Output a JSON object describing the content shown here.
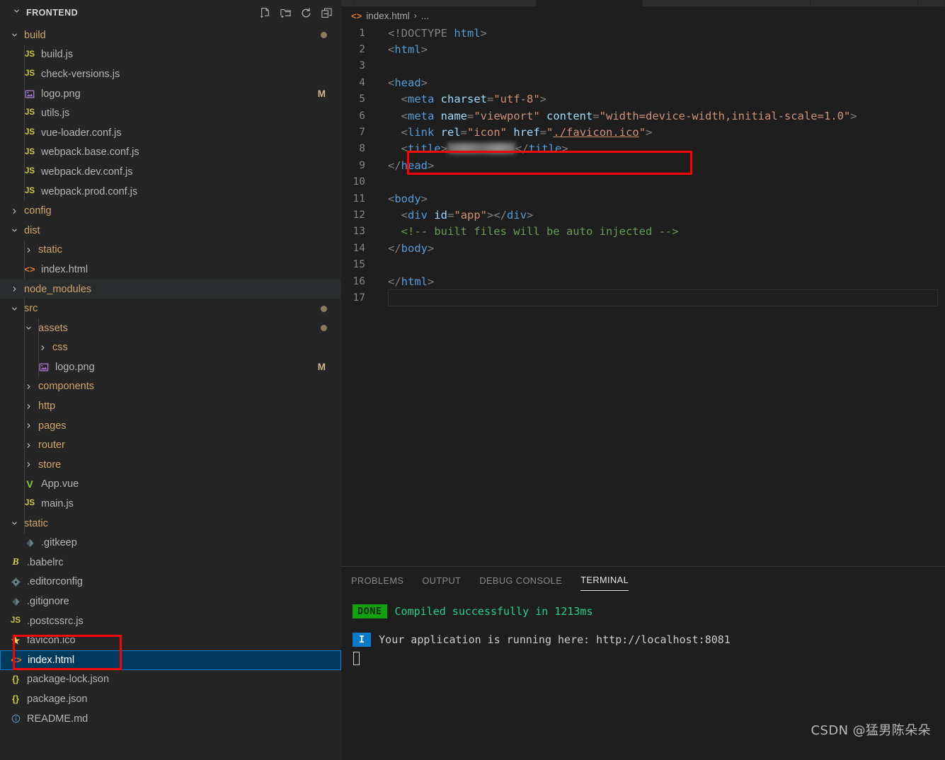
{
  "sidebar": {
    "title": "FRONTEND",
    "actions": [
      {
        "name": "new-file-icon",
        "label": "New File"
      },
      {
        "name": "new-folder-icon",
        "label": "New Folder"
      },
      {
        "name": "refresh-icon",
        "label": "Refresh Explorer"
      },
      {
        "name": "collapse-all-icon",
        "label": "Collapse Folders in Explorer"
      }
    ],
    "tree": [
      {
        "label": "build",
        "type": "folder",
        "depth": 0,
        "expanded": true,
        "icon": "chevron-down-icon",
        "badge": "",
        "dot": true
      },
      {
        "label": "build.js",
        "type": "js",
        "depth": 1,
        "icon": "js-icon",
        "badge": ""
      },
      {
        "label": "check-versions.js",
        "type": "js",
        "depth": 1,
        "icon": "js-icon",
        "badge": ""
      },
      {
        "label": "logo.png",
        "type": "image",
        "depth": 1,
        "icon": "image-icon",
        "badge": "M"
      },
      {
        "label": "utils.js",
        "type": "js",
        "depth": 1,
        "icon": "js-icon",
        "badge": ""
      },
      {
        "label": "vue-loader.conf.js",
        "type": "js",
        "depth": 1,
        "icon": "js-icon",
        "badge": ""
      },
      {
        "label": "webpack.base.conf.js",
        "type": "js",
        "depth": 1,
        "icon": "js-icon",
        "badge": ""
      },
      {
        "label": "webpack.dev.conf.js",
        "type": "js",
        "depth": 1,
        "icon": "js-icon",
        "badge": ""
      },
      {
        "label": "webpack.prod.conf.js",
        "type": "js",
        "depth": 1,
        "icon": "js-icon",
        "badge": ""
      },
      {
        "label": "config",
        "type": "folder",
        "depth": 0,
        "expanded": false,
        "icon": "chevron-right-icon",
        "badge": ""
      },
      {
        "label": "dist",
        "type": "folder",
        "depth": 0,
        "expanded": true,
        "icon": "chevron-down-icon",
        "badge": ""
      },
      {
        "label": "static",
        "type": "folder",
        "depth": 1,
        "expanded": false,
        "icon": "chevron-right-icon",
        "badge": ""
      },
      {
        "label": "index.html",
        "type": "html",
        "depth": 1,
        "icon": "html-icon",
        "badge": ""
      },
      {
        "label": "node_modules",
        "type": "folder",
        "depth": 0,
        "expanded": false,
        "icon": "chevron-right-icon",
        "badge": "",
        "hover": true
      },
      {
        "label": "src",
        "type": "folder",
        "depth": 0,
        "expanded": true,
        "icon": "chevron-down-icon",
        "badge": "",
        "dot": true
      },
      {
        "label": "assets",
        "type": "folder",
        "depth": 1,
        "expanded": true,
        "icon": "chevron-down-icon",
        "badge": "",
        "dot": true
      },
      {
        "label": "css",
        "type": "folder",
        "depth": 2,
        "expanded": false,
        "icon": "chevron-right-icon",
        "badge": ""
      },
      {
        "label": "logo.png",
        "type": "image",
        "depth": 2,
        "icon": "image-icon",
        "badge": "M"
      },
      {
        "label": "components",
        "type": "folder",
        "depth": 1,
        "expanded": false,
        "icon": "chevron-right-icon",
        "badge": ""
      },
      {
        "label": "http",
        "type": "folder",
        "depth": 1,
        "expanded": false,
        "icon": "chevron-right-icon",
        "badge": ""
      },
      {
        "label": "pages",
        "type": "folder",
        "depth": 1,
        "expanded": false,
        "icon": "chevron-right-icon",
        "badge": ""
      },
      {
        "label": "router",
        "type": "folder",
        "depth": 1,
        "expanded": false,
        "icon": "chevron-right-icon",
        "badge": ""
      },
      {
        "label": "store",
        "type": "folder",
        "depth": 1,
        "expanded": false,
        "icon": "chevron-right-icon",
        "badge": ""
      },
      {
        "label": "App.vue",
        "type": "vue",
        "depth": 1,
        "icon": "vue-icon",
        "badge": ""
      },
      {
        "label": "main.js",
        "type": "js",
        "depth": 1,
        "icon": "js-icon",
        "badge": ""
      },
      {
        "label": "static",
        "type": "folder",
        "depth": 0,
        "expanded": true,
        "icon": "chevron-down-icon",
        "badge": ""
      },
      {
        "label": ".gitkeep",
        "type": "git",
        "depth": 1,
        "icon": "git-icon",
        "badge": ""
      },
      {
        "label": ".babelrc",
        "type": "babel",
        "depth": 0,
        "icon": "babel-icon",
        "badge": ""
      },
      {
        "label": ".editorconfig",
        "type": "gear",
        "depth": 0,
        "icon": "gear-icon",
        "badge": ""
      },
      {
        "label": ".gitignore",
        "type": "git",
        "depth": 0,
        "icon": "git-icon",
        "badge": ""
      },
      {
        "label": ".postcssrc.js",
        "type": "js",
        "depth": 0,
        "icon": "js-icon",
        "badge": ""
      },
      {
        "label": "favicon.ico",
        "type": "star",
        "depth": 0,
        "icon": "star-icon",
        "badge": ""
      },
      {
        "label": "index.html",
        "type": "html",
        "depth": 0,
        "icon": "html-icon",
        "badge": "",
        "selected": true
      },
      {
        "label": "package-lock.json",
        "type": "json",
        "depth": 0,
        "icon": "json-icon",
        "badge": ""
      },
      {
        "label": "package.json",
        "type": "json",
        "depth": 0,
        "icon": "json-icon",
        "badge": ""
      },
      {
        "label": "README.md",
        "type": "md",
        "depth": 0,
        "icon": "info-icon",
        "badge": ""
      }
    ]
  },
  "editor": {
    "breadcrumb": {
      "file": "index.html",
      "separator": "›",
      "rest": "..."
    },
    "lines": [
      {
        "n": "1",
        "tokens": [
          {
            "t": "<!DOCTYPE ",
            "c": "t-punct"
          },
          {
            "t": "html",
            "c": "t-tag"
          },
          {
            "t": ">",
            "c": "t-punct"
          }
        ]
      },
      {
        "n": "2",
        "tokens": [
          {
            "t": "<",
            "c": "t-punct"
          },
          {
            "t": "html",
            "c": "t-tag"
          },
          {
            "t": ">",
            "c": "t-punct"
          }
        ]
      },
      {
        "n": "3",
        "tokens": []
      },
      {
        "n": "4",
        "tokens": [
          {
            "t": "<",
            "c": "t-punct"
          },
          {
            "t": "head",
            "c": "t-tag"
          },
          {
            "t": ">",
            "c": "t-punct"
          }
        ]
      },
      {
        "n": "5",
        "tokens": [
          {
            "t": "  <",
            "c": "t-punct"
          },
          {
            "t": "meta",
            "c": "t-tag"
          },
          {
            "t": " ",
            "c": "t-plain"
          },
          {
            "t": "charset",
            "c": "t-attr"
          },
          {
            "t": "=",
            "c": "t-punct"
          },
          {
            "t": "\"utf-8\"",
            "c": "t-str"
          },
          {
            "t": ">",
            "c": "t-punct"
          }
        ]
      },
      {
        "n": "6",
        "tokens": [
          {
            "t": "  <",
            "c": "t-punct"
          },
          {
            "t": "meta",
            "c": "t-tag"
          },
          {
            "t": " ",
            "c": "t-plain"
          },
          {
            "t": "name",
            "c": "t-attr"
          },
          {
            "t": "=",
            "c": "t-punct"
          },
          {
            "t": "\"viewport\"",
            "c": "t-str"
          },
          {
            "t": " ",
            "c": "t-plain"
          },
          {
            "t": "content",
            "c": "t-attr"
          },
          {
            "t": "=",
            "c": "t-punct"
          },
          {
            "t": "\"width=device-width,initial-scale=1.0\"",
            "c": "t-str"
          },
          {
            "t": ">",
            "c": "t-punct"
          }
        ]
      },
      {
        "n": "7",
        "tokens": [
          {
            "t": "  <",
            "c": "t-punct"
          },
          {
            "t": "link",
            "c": "t-tag"
          },
          {
            "t": " ",
            "c": "t-plain"
          },
          {
            "t": "rel",
            "c": "t-attr"
          },
          {
            "t": "=",
            "c": "t-punct"
          },
          {
            "t": "\"icon\"",
            "c": "t-str"
          },
          {
            "t": " ",
            "c": "t-plain"
          },
          {
            "t": "href",
            "c": "t-attr"
          },
          {
            "t": "=",
            "c": "t-punct"
          },
          {
            "t": "\"",
            "c": "t-str"
          },
          {
            "t": "./favicon.ico",
            "c": "t-str u-squiggle"
          },
          {
            "t": "\"",
            "c": "t-str"
          },
          {
            "t": ">",
            "c": "t-punct"
          }
        ]
      },
      {
        "n": "8",
        "tokens": [
          {
            "t": "  <",
            "c": "t-punct"
          },
          {
            "t": "title",
            "c": "t-tag"
          },
          {
            "t": ">",
            "c": "t-punct"
          }
        ],
        "blurred": true,
        "after": [
          {
            "t": "</",
            "c": "t-punct"
          },
          {
            "t": "title",
            "c": "t-tag"
          },
          {
            "t": ">",
            "c": "t-punct"
          }
        ]
      },
      {
        "n": "9",
        "tokens": [
          {
            "t": "</",
            "c": "t-punct"
          },
          {
            "t": "head",
            "c": "t-tag"
          },
          {
            "t": ">",
            "c": "t-punct"
          }
        ]
      },
      {
        "n": "10",
        "tokens": []
      },
      {
        "n": "11",
        "tokens": [
          {
            "t": "<",
            "c": "t-punct"
          },
          {
            "t": "body",
            "c": "t-tag"
          },
          {
            "t": ">",
            "c": "t-punct"
          }
        ]
      },
      {
        "n": "12",
        "tokens": [
          {
            "t": "  <",
            "c": "t-punct"
          },
          {
            "t": "div",
            "c": "t-tag"
          },
          {
            "t": " ",
            "c": "t-plain"
          },
          {
            "t": "id",
            "c": "t-attr"
          },
          {
            "t": "=",
            "c": "t-punct"
          },
          {
            "t": "\"app\"",
            "c": "t-str"
          },
          {
            "t": ">",
            "c": "t-punct"
          },
          {
            "t": "</",
            "c": "t-punct"
          },
          {
            "t": "div",
            "c": "t-tag"
          },
          {
            "t": ">",
            "c": "t-punct"
          }
        ]
      },
      {
        "n": "13",
        "tokens": [
          {
            "t": "  <!-- built files will be auto injected -->",
            "c": "t-comment"
          }
        ]
      },
      {
        "n": "14",
        "tokens": [
          {
            "t": "</",
            "c": "t-punct"
          },
          {
            "t": "body",
            "c": "t-tag"
          },
          {
            "t": ">",
            "c": "t-punct"
          }
        ]
      },
      {
        "n": "15",
        "tokens": []
      },
      {
        "n": "16",
        "tokens": [
          {
            "t": "</",
            "c": "t-punct"
          },
          {
            "t": "html",
            "c": "t-tag"
          },
          {
            "t": ">",
            "c": "t-punct"
          }
        ]
      },
      {
        "n": "17",
        "tokens": [],
        "current": true
      }
    ]
  },
  "panel": {
    "tabs": [
      {
        "label": "PROBLEMS",
        "active": false
      },
      {
        "label": "OUTPUT",
        "active": false
      },
      {
        "label": "DEBUG CONSOLE",
        "active": false
      },
      {
        "label": "TERMINAL",
        "active": true
      }
    ],
    "terminal": {
      "done_badge": "DONE",
      "done_message": "Compiled successfully in 1213ms",
      "info_badge": "I",
      "info_message": "Your application is running here: http://localhost:8081"
    }
  },
  "watermark": "CSDN @猛男陈朵朵",
  "colors": {
    "sidebar_bg": "#252526",
    "editor_bg": "#1e1e1e",
    "selection_bg": "#04395e",
    "selection_border": "#0a7aca",
    "annotation_red": "#ff0000",
    "done_green": "#13a10e",
    "info_blue": "#0a7aca",
    "terminal_green": "#23d18b",
    "folder_text": "#cfa46a"
  }
}
